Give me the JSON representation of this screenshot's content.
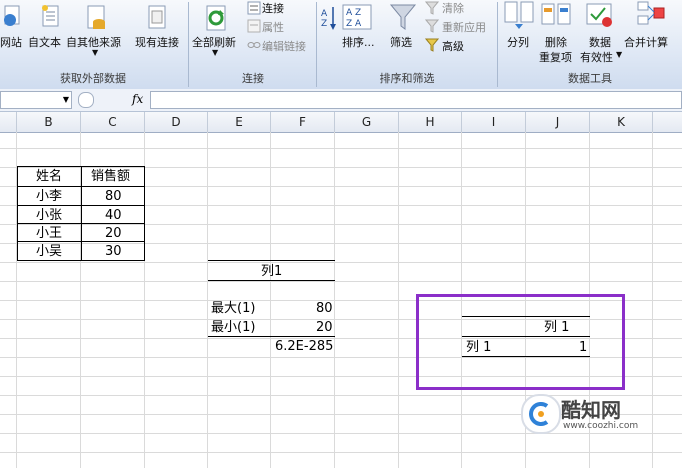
{
  "ribbon": {
    "get_external": {
      "web": "网站",
      "text": "自文本",
      "other": "自其他来源",
      "existing": "现有连接",
      "label": "获取外部数据"
    },
    "connections": {
      "refresh_all": "全部刷新",
      "connections": "连接",
      "properties": "属性",
      "edit_links": "编辑链接",
      "label": "连接"
    },
    "sort_filter": {
      "sort": "排序...",
      "filter": "筛选",
      "clear": "清除",
      "reapply": "重新应用",
      "advanced": "高级",
      "label": "排序和筛选"
    },
    "data_tools": {
      "text_to_columns": "分列",
      "remove_dup_1": "删除",
      "remove_dup_2": "重复项",
      "validation_1": "数据",
      "validation_2": "有效性",
      "consolidate": "合并计算",
      "label": "数据工具"
    },
    "az": "A Z",
    "za": "Z A"
  },
  "formula_bar": {
    "name_box": "",
    "fx": "fx",
    "value": ""
  },
  "columns": [
    "B",
    "C",
    "D",
    "E",
    "F",
    "G",
    "H",
    "I",
    "J",
    "K"
  ],
  "sheet": {
    "table1": {
      "headers": [
        "姓名",
        "销售额"
      ],
      "rows": [
        [
          "小李",
          "80"
        ],
        [
          "小张",
          "40"
        ],
        [
          "小王",
          "20"
        ],
        [
          "小吴",
          "30"
        ]
      ]
    },
    "stats": {
      "col_header": "列1",
      "max_label": "最大(1)",
      "max_value": "80",
      "min_label": "最小(1)",
      "min_value": "20",
      "p_value": "6.2E-285"
    },
    "corr": {
      "col_header": "列 1",
      "row_label": "列 1",
      "value": "1"
    },
    "highlight_color": "#8b2fc9"
  },
  "watermark": {
    "name": "酷知网",
    "url": "www.coozhi.com"
  }
}
